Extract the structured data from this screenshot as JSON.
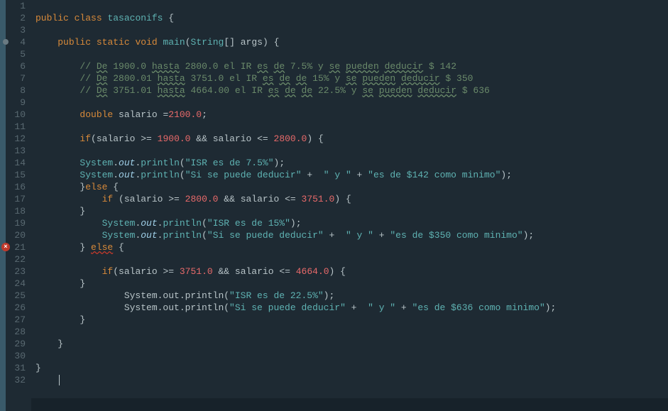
{
  "lines": [
    {
      "n": "1",
      "txt": ""
    },
    {
      "n": "2",
      "txt": "<span class='kw'>public</span> <span class='kw'>class</span> <span class='cls'>tasaconifs</span> {"
    },
    {
      "n": "3",
      "txt": ""
    },
    {
      "n": "4",
      "marker": "main",
      "txt": "    <span class='kw'>public</span> <span class='kw'>static</span> <span class='kw'>void</span> <span class='mth'>main</span>(<span class='cls'>String</span>[] <span class='var'>args</span>) {"
    },
    {
      "n": "5",
      "txt": ""
    },
    {
      "n": "6",
      "txt": "        <span class='cmt'>// <span class='wavy'>De</span> 1900.0 <span class='wavy'>hasta</span> 2800.0 el IR <span class='wavy'>es</span> <span class='wavy'>de</span> 7.5% y <span class='wavy'>se</span> <span class='wavy'>pueden</span> <span class='wavy'>deducir</span> $ 142</span>"
    },
    {
      "n": "7",
      "txt": "        <span class='cmt'>// <span class='wavy'>De</span> 2800.01 <span class='wavy'>hasta</span> 3751.0 el IR <span class='wavy'>es</span> <span class='wavy'>de</span> <span class='wavy'>de</span> 15% y <span class='wavy'>se</span> <span class='wavy'>pueden</span> <span class='wavy'>deducir</span> $ 350</span>"
    },
    {
      "n": "8",
      "txt": "        <span class='cmt'>// <span class='wavy'>De</span> 3751.01 <span class='wavy'>hasta</span> 4664.00 el IR <span class='wavy'>es</span> <span class='wavy'>de</span> <span class='wavy'>de</span> 22.5% y <span class='wavy'>se</span> <span class='wavy'>pueden</span> <span class='wavy'>deducir</span> $ 636</span>"
    },
    {
      "n": "9",
      "txt": ""
    },
    {
      "n": "10",
      "txt": "        <span class='kw'>double</span> <span class='var'>salario</span> =<span class='num'>2100.0</span>;"
    },
    {
      "n": "11",
      "txt": ""
    },
    {
      "n": "12",
      "txt": "        <span class='kw'>if</span>(<span class='var'>salario</span> >= <span class='num'>1900.0</span> && <span class='var'>salario</span> <= <span class='num'>2800.0</span>) {"
    },
    {
      "n": "13",
      "txt": ""
    },
    {
      "n": "14",
      "txt": "        <span class='cls'>System</span>.<span class='field'>out</span>.<span class='mth'>println</span>(<span class='str'>\"ISR es de 7.5%\"</span>);"
    },
    {
      "n": "15",
      "txt": "        <span class='cls'>System</span>.<span class='field'>out</span>.<span class='mth'>println</span>(<span class='str'>\"Si se puede deducir\"</span> +  <span class='str'>\" y \"</span> + <span class='str'>\"es de $142 como minimo\"</span>);"
    },
    {
      "n": "16",
      "txt": "        }<span class='kw'>else</span> {"
    },
    {
      "n": "17",
      "txt": "            <span class='kw'>if</span> (<span class='var'>salario</span> >= <span class='num'>2800.0</span> && <span class='var'>salario</span> <= <span class='num'>3751.0</span>) {"
    },
    {
      "n": "18",
      "txt": "        }"
    },
    {
      "n": "19",
      "txt": "            <span class='cls'>System</span>.<span class='field'>out</span>.<span class='mth'>println</span>(<span class='str'>\"ISR es de 15%\"</span>);"
    },
    {
      "n": "20",
      "txt": "            <span class='cls'>System</span>.<span class='field'>out</span>.<span class='mth'>println</span>(<span class='str'>\"Si se puede deducir\"</span> +  <span class='str'>\" y \"</span> + <span class='str'>\"es de $350 como minimo\"</span>);"
    },
    {
      "n": "21",
      "marker": "error",
      "txt": "        } <span class='kw wavy-err'>else</span> {"
    },
    {
      "n": "22",
      "txt": ""
    },
    {
      "n": "23",
      "txt": "            <span class='kw'>if</span>(<span class='var'>salario</span> >= <span class='num'>3751.0</span> && <span class='var'>salario</span> <= <span class='num'>4664.0</span>) {"
    },
    {
      "n": "24",
      "txt": "        }"
    },
    {
      "n": "25",
      "txt": "                System.out.println(<span class='str'>\"ISR es de 22.5%\"</span>);"
    },
    {
      "n": "26",
      "txt": "                System.out.println(<span class='str'>\"Si se puede deducir\"</span> +  <span class='str'>\" y \"</span> + <span class='str'>\"es de $636 como minimo\"</span>);"
    },
    {
      "n": "27",
      "txt": "        }"
    },
    {
      "n": "28",
      "txt": ""
    },
    {
      "n": "29",
      "txt": "    }"
    },
    {
      "n": "30",
      "txt": ""
    },
    {
      "n": "31",
      "txt": "}"
    },
    {
      "n": "32",
      "txt": "    <span class='cursor'></span>"
    }
  ]
}
